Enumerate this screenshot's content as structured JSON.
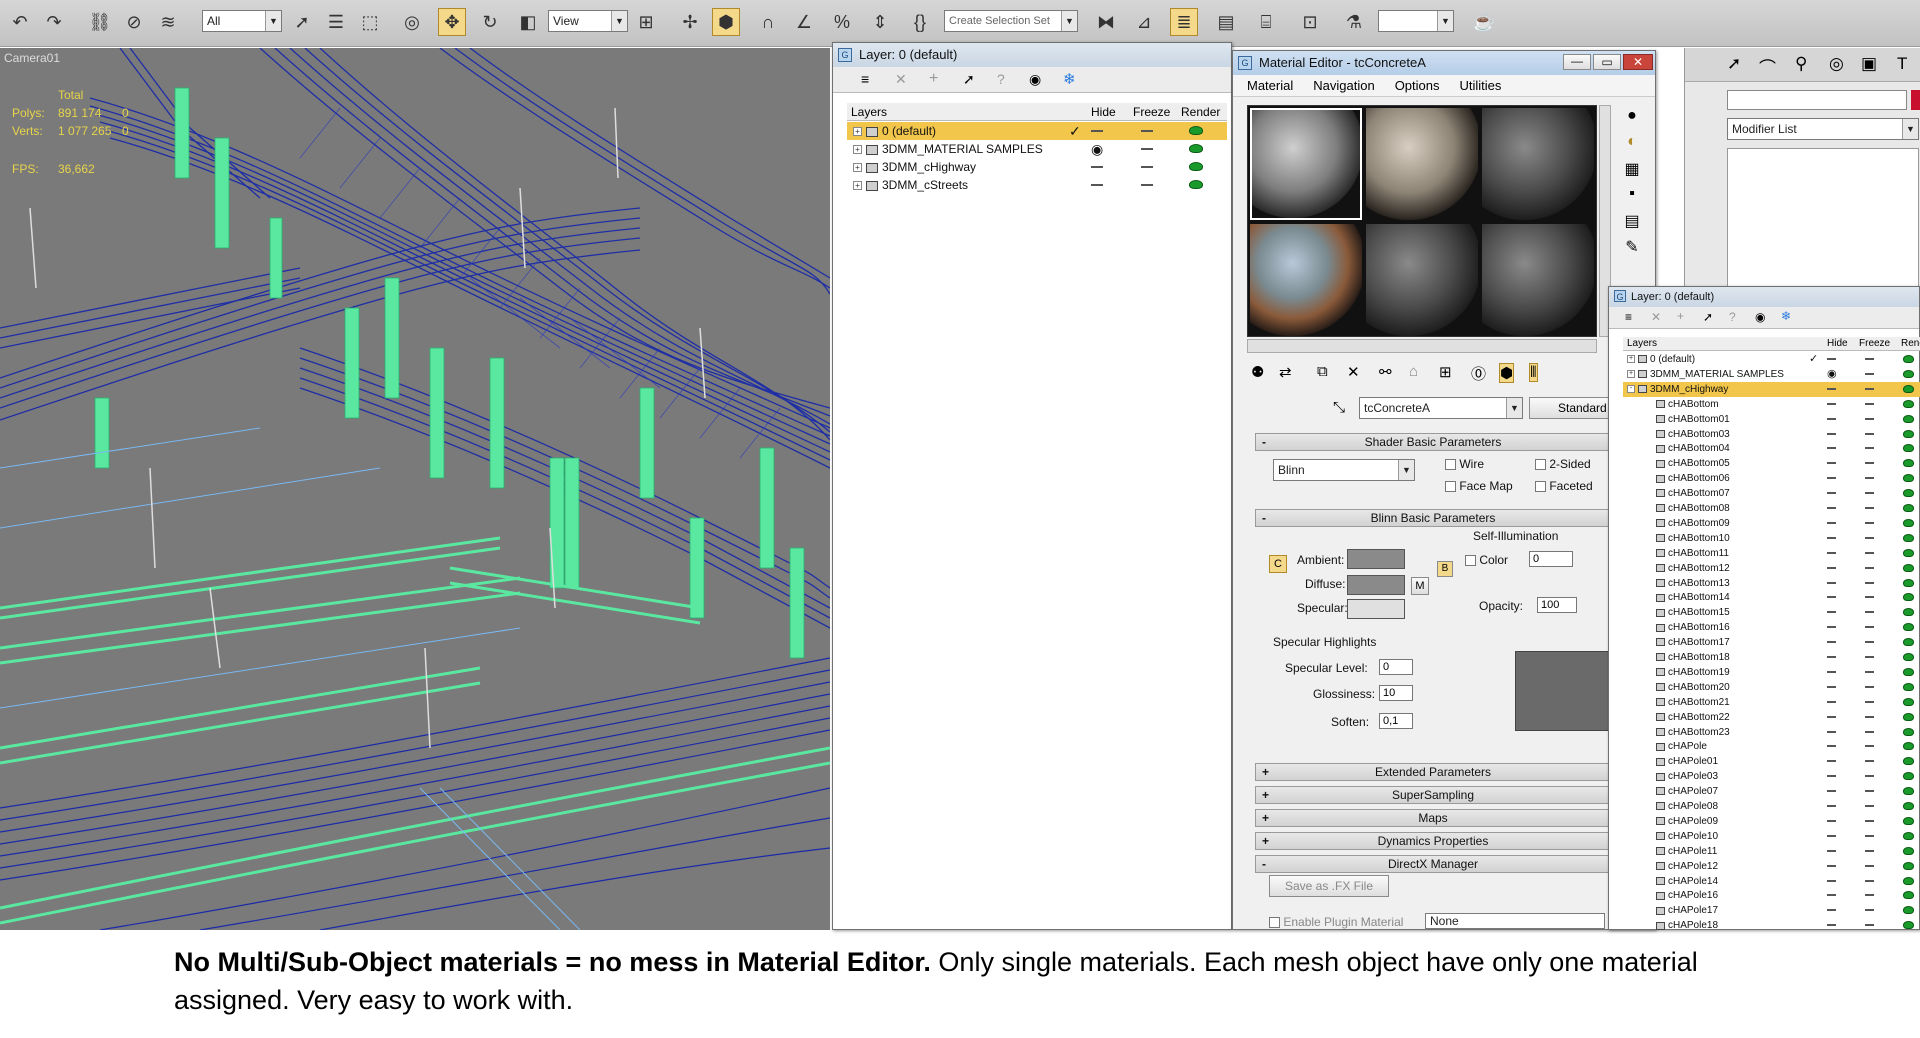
{
  "toolbar": {
    "selection_filter": "All",
    "ref_coord": "View",
    "named_selection": "Create Selection Set",
    "icons": [
      "undo-icon",
      "redo-icon",
      "select-link-icon",
      "unlink-icon",
      "bind-space-warp-icon",
      "select-object-icon",
      "select-by-name-icon",
      "rect-region-icon",
      "window-crossing-icon",
      "select-move-icon",
      "select-rotate-icon",
      "select-scale-icon",
      "ref-coord-icon",
      "pivot-icon",
      "select-manipulate-icon",
      "keyboard-shortcut-icon",
      "snap-toggle-icon",
      "angle-snap-icon",
      "percent-snap-icon",
      "spinner-snap-icon",
      "edit-named-sel-icon",
      "mirror-icon",
      "align-icon",
      "layer-manager-icon",
      "graphite-icon",
      "curve-editor-icon",
      "schematic-icon",
      "material-editor-icon",
      "render-setup-icon",
      "rendered-frame-icon",
      "render-icon"
    ]
  },
  "viewport": {
    "label": "Camera01",
    "stats_total": "Total",
    "polys_label": "Polys:",
    "polys_value": "891 174",
    "polys_zero": "0",
    "verts_label": "Verts:",
    "verts_value": "1 077 265",
    "verts_zero": "0",
    "fps_label": "FPS:",
    "fps_value": "36,662"
  },
  "layer_window": {
    "title": "Layer: 0 (default)",
    "columns": {
      "layers": "Layers",
      "hide": "Hide",
      "freeze": "Freeze",
      "render": "Render"
    },
    "rows": [
      {
        "name": "0 (default)",
        "active": true
      },
      {
        "name": "3DMM_MATERIAL SAMPLES",
        "hidden": true
      },
      {
        "name": "3DMM_cHighway"
      },
      {
        "name": "3DMM_cStreets"
      }
    ]
  },
  "material_editor": {
    "title": "Material Editor - tcConcreteA",
    "menu": [
      "Material",
      "Navigation",
      "Options",
      "Utilities"
    ],
    "material_name": "tcConcreteA",
    "material_type": "Standard",
    "shader_rollout": "Shader Basic Parameters",
    "shader": "Blinn",
    "wire_label": "Wire",
    "two_sided_label": "2-Sided",
    "face_map_label": "Face Map",
    "faceted_label": "Faceted",
    "blinn_rollout": "Blinn Basic Parameters",
    "self_illum_label": "Self-Illumination",
    "color_label": "Color",
    "color_value": "0",
    "ambient_label": "Ambient:",
    "diffuse_label": "Diffuse:",
    "specular_label": "Specular:",
    "map_button": "M",
    "opacity_label": "Opacity:",
    "opacity_value": "100",
    "spec_highlights_label": "Specular Highlights",
    "spec_level_label": "Specular Level:",
    "spec_level_value": "0",
    "glossiness_label": "Glossiness:",
    "glossiness_value": "10",
    "soften_label": "Soften:",
    "soften_value": "0,1",
    "rollouts": [
      {
        "sign": "+",
        "label": "Extended Parameters"
      },
      {
        "sign": "+",
        "label": "SuperSampling"
      },
      {
        "sign": "+",
        "label": "Maps"
      },
      {
        "sign": "+",
        "label": "Dynamics Properties"
      },
      {
        "sign": "-",
        "label": "DirectX Manager"
      }
    ],
    "save_fx_button": "Save as .FX File",
    "enable_plugin_label": "Enable Plugin Material",
    "plugin_value": "None",
    "ambient_letter": "C",
    "lock_letter": "B"
  },
  "command_panel": {
    "modifier_list": "Modifier List"
  },
  "layer_window2": {
    "title": "Layer: 0 (default)",
    "columns": {
      "layers": "Layers",
      "hide": "Hide",
      "freeze": "Freeze",
      "render": "Rende"
    },
    "rows": [
      {
        "name": "0 (default)",
        "level": 0,
        "expand": true,
        "active": true
      },
      {
        "name": "3DMM_MATERIAL SAMPLES",
        "level": 0,
        "expand": true,
        "hidden": true
      },
      {
        "name": "3DMM_cHighway",
        "level": 0,
        "expand": true,
        "selected": true
      },
      {
        "name": "cHABottom",
        "level": 1
      },
      {
        "name": "cHABottom01",
        "level": 1
      },
      {
        "name": "cHABottom03",
        "level": 1
      },
      {
        "name": "cHABottom04",
        "level": 1
      },
      {
        "name": "cHABottom05",
        "level": 1
      },
      {
        "name": "cHABottom06",
        "level": 1
      },
      {
        "name": "cHABottom07",
        "level": 1
      },
      {
        "name": "cHABottom08",
        "level": 1
      },
      {
        "name": "cHABottom09",
        "level": 1
      },
      {
        "name": "cHABottom10",
        "level": 1
      },
      {
        "name": "cHABottom11",
        "level": 1
      },
      {
        "name": "cHABottom12",
        "level": 1
      },
      {
        "name": "cHABottom13",
        "level": 1
      },
      {
        "name": "cHABottom14",
        "level": 1
      },
      {
        "name": "cHABottom15",
        "level": 1
      },
      {
        "name": "cHABottom16",
        "level": 1
      },
      {
        "name": "cHABottom17",
        "level": 1
      },
      {
        "name": "cHABottom18",
        "level": 1
      },
      {
        "name": "cHABottom19",
        "level": 1
      },
      {
        "name": "cHABottom20",
        "level": 1
      },
      {
        "name": "cHABottom21",
        "level": 1
      },
      {
        "name": "cHABottom22",
        "level": 1
      },
      {
        "name": "cHABottom23",
        "level": 1
      },
      {
        "name": "cHAPole",
        "level": 1
      },
      {
        "name": "cHAPole01",
        "level": 1
      },
      {
        "name": "cHAPole03",
        "level": 1
      },
      {
        "name": "cHAPole07",
        "level": 1
      },
      {
        "name": "cHAPole08",
        "level": 1
      },
      {
        "name": "cHAPole09",
        "level": 1
      },
      {
        "name": "cHAPole10",
        "level": 1
      },
      {
        "name": "cHAPole11",
        "level": 1
      },
      {
        "name": "cHAPole12",
        "level": 1
      },
      {
        "name": "cHAPole14",
        "level": 1
      },
      {
        "name": "cHAPole16",
        "level": 1
      },
      {
        "name": "cHAPole17",
        "level": 1
      },
      {
        "name": "cHAPole18",
        "level": 1
      }
    ]
  },
  "caption": {
    "bold": "No Multi/Sub-Object materials = no mess in Material Editor.",
    "rest": " Only single materials. Each mesh object have only one material assigned. Very easy to work with."
  },
  "colors": {
    "wire_blue": "#1a2aa8",
    "wire_green": "#5ae8a0",
    "viewport_bg": "#7a7a7a",
    "selected_row": "#f2c64a"
  }
}
